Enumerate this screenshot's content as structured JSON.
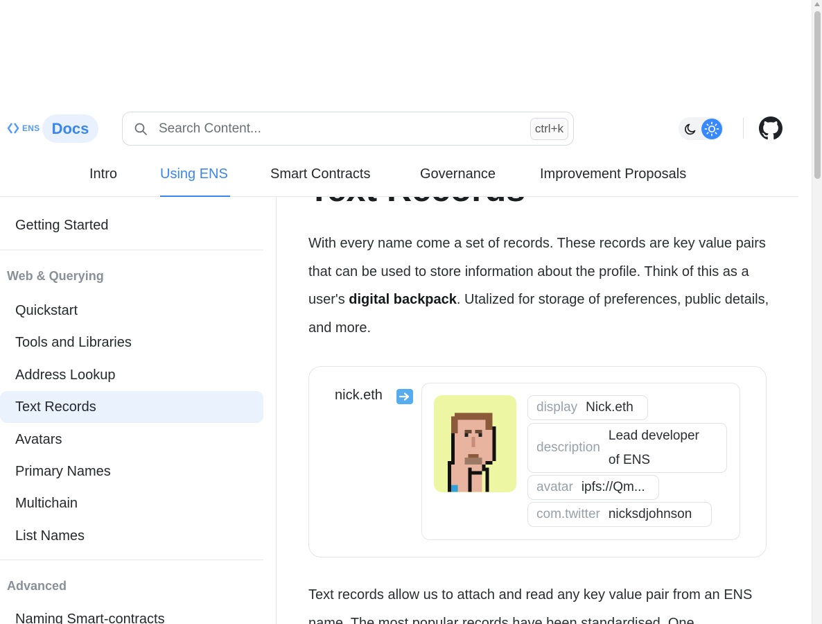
{
  "header": {
    "logo_text": "ENS",
    "docs_label": "Docs",
    "search": {
      "placeholder": "Search Content...",
      "shortcut": "ctrl+k"
    },
    "theme": {
      "moon_icon": "moon-icon",
      "sun_icon": "sun-icon",
      "active": "light"
    },
    "github_icon": "github-icon"
  },
  "tabs": [
    {
      "label": "Intro"
    },
    {
      "label": "Using ENS",
      "active": true
    },
    {
      "label": "Smart Contracts"
    },
    {
      "label": "Governance"
    },
    {
      "label": "Improvement Proposals"
    }
  ],
  "sidebar": {
    "top_item": "Getting Started",
    "section1": {
      "heading": "Web & Querying",
      "items": [
        "Quickstart",
        "Tools and Libraries",
        "Address Lookup",
        "Text Records",
        "Avatars",
        "Primary Names",
        "Multichain",
        "List Names"
      ]
    },
    "active_item": "Text Records",
    "section2": {
      "heading": "Advanced",
      "items": [
        "Naming Smart-contracts"
      ]
    }
  },
  "main": {
    "title": "Text Records",
    "intro_1": "With every name come a set of records. These records are key value pairs that can be used to store information about the profile. Think of this as a user's ",
    "intro_bold": "digital backpack",
    "intro_2": ". Utalized for storage of preferences, public details, and more.",
    "demo": {
      "name": "nick.eth",
      "arrow_icon": "right-arrow-icon",
      "records": [
        {
          "key": "display",
          "value": "Nick.eth"
        },
        {
          "key": "description",
          "value": "Lead developer of ENS"
        },
        {
          "key": "avatar",
          "value": "ipfs://Qm..."
        },
        {
          "key": "com.twitter",
          "value": "nicksdjohnson"
        }
      ]
    },
    "para2": "Text records allow us to attach and read any key value pair from an ENS name. The most popular records have been standardised. One"
  },
  "colors": {
    "accent": "#3a86f0",
    "active_bg": "#eaf2fd",
    "avatar_bg": "#edf7a3"
  }
}
